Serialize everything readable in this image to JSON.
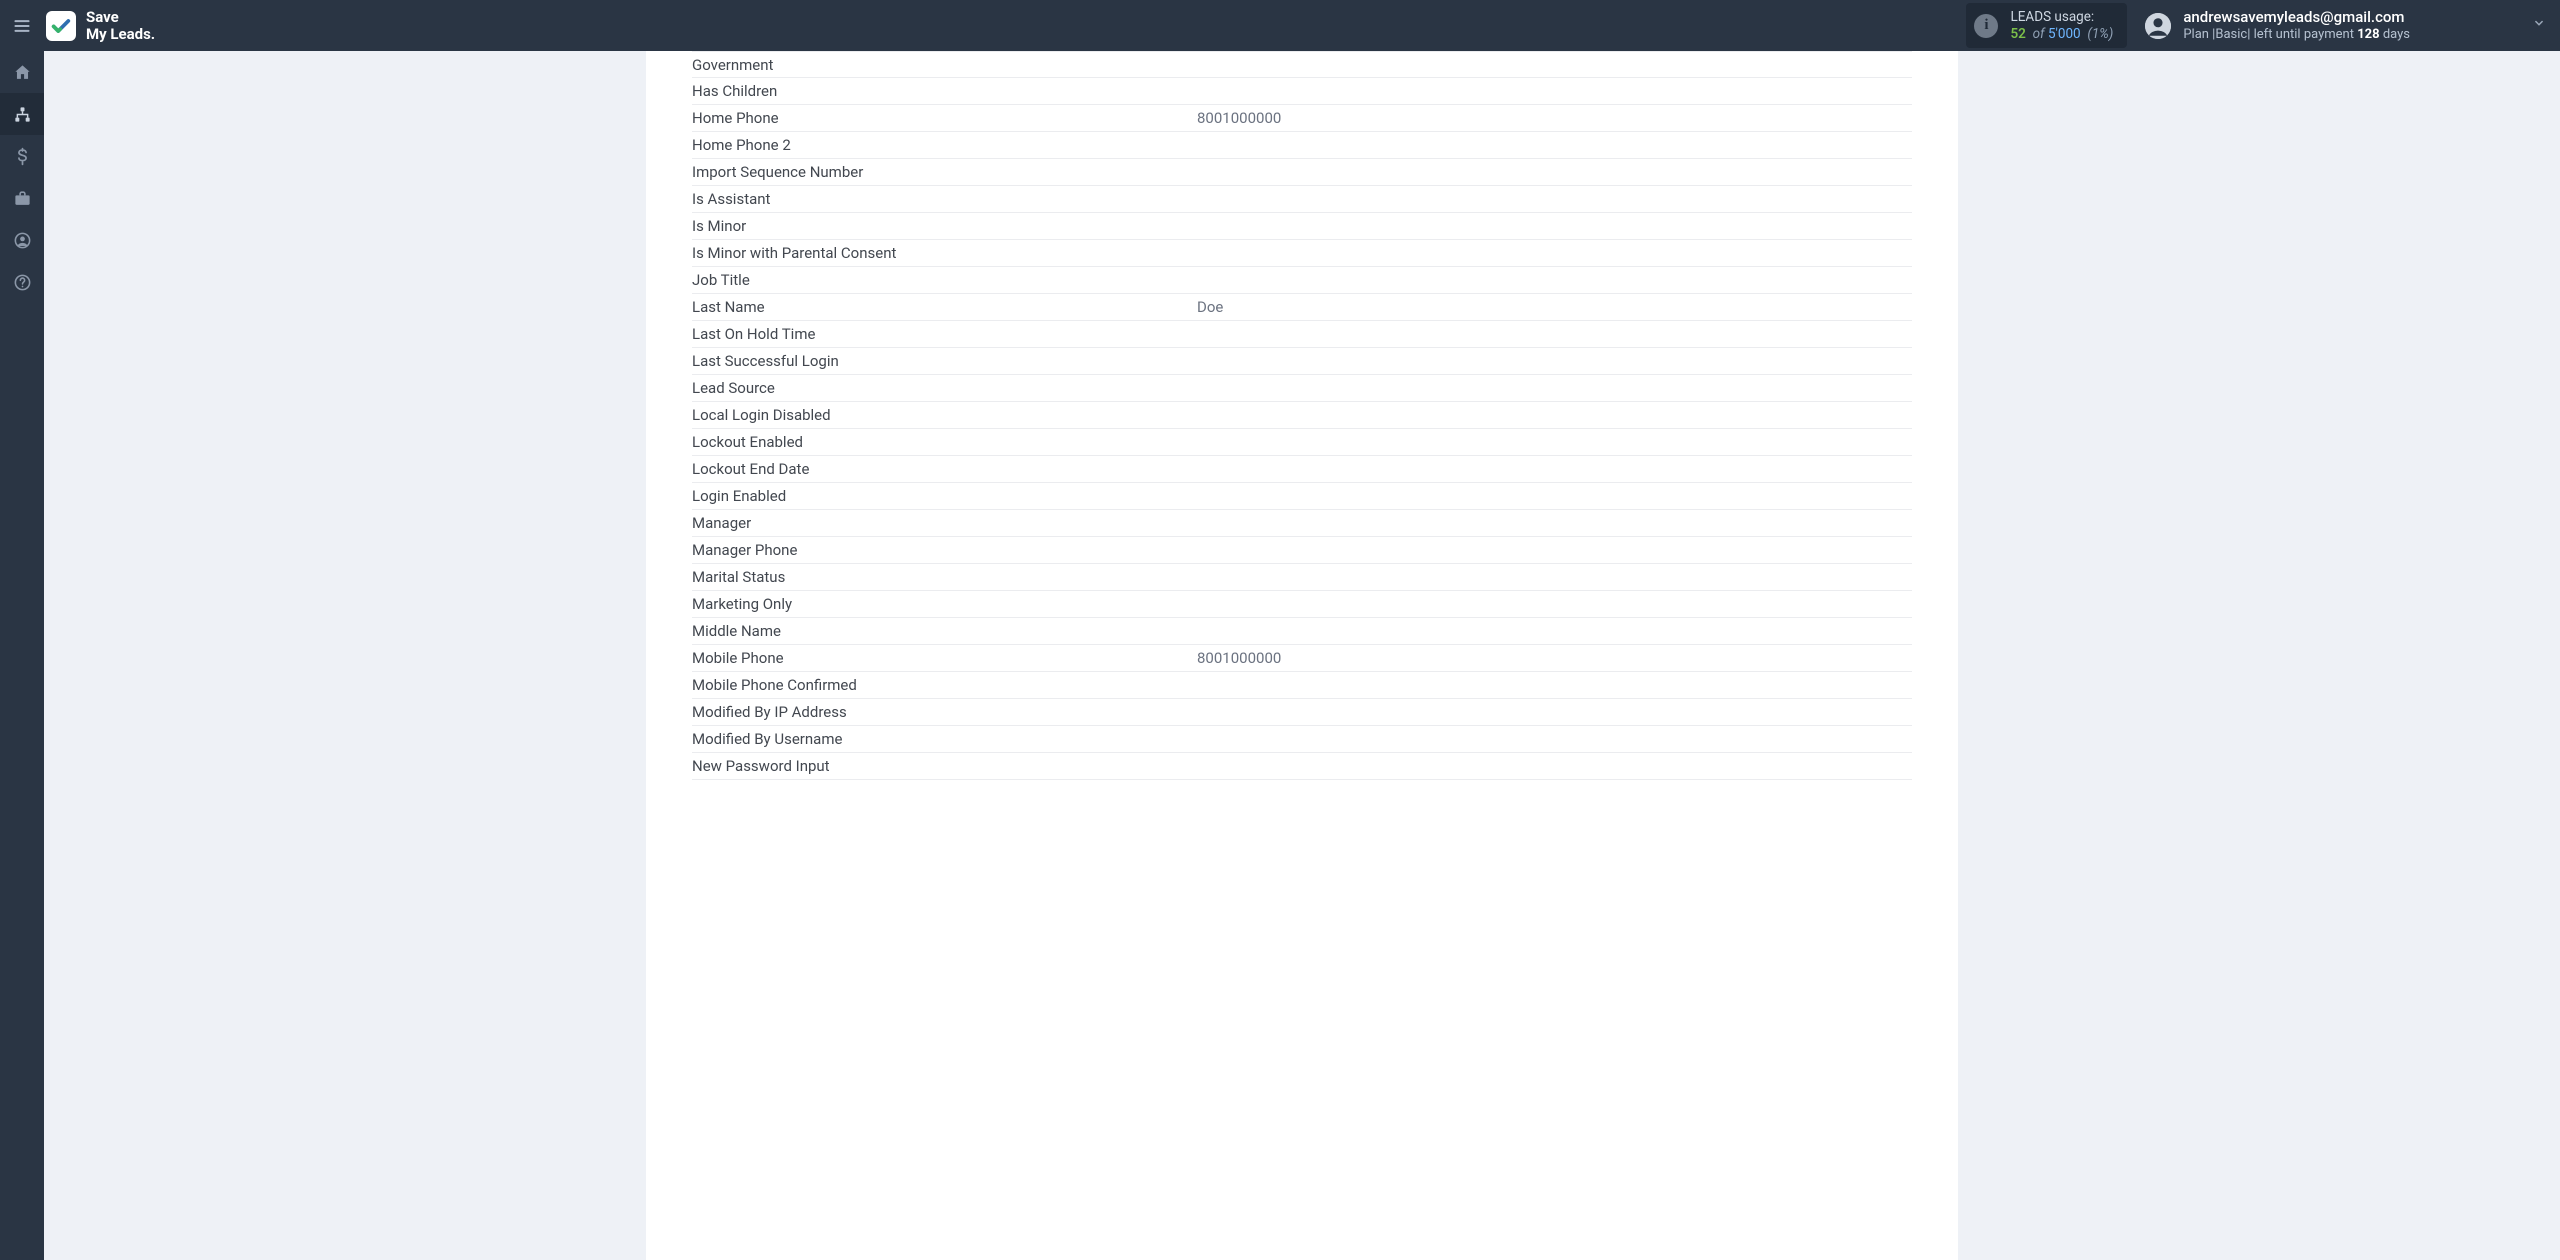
{
  "brand": {
    "line1": "Save",
    "line2": "My Leads."
  },
  "usage": {
    "label": "LEADS usage:",
    "used": "52",
    "of": "of",
    "total": "5'000",
    "pct": "(1%)"
  },
  "account": {
    "email": "andrewsavemyleads@gmail.com",
    "plan_prefix": "Plan |",
    "plan_name": "Basic",
    "plan_mid": "| left until payment ",
    "days_num": "128",
    "days_word": " days"
  },
  "sidebar": {
    "items": [
      {
        "name": "home"
      },
      {
        "name": "connections"
      },
      {
        "name": "billing"
      },
      {
        "name": "briefcase"
      },
      {
        "name": "profile"
      },
      {
        "name": "help"
      }
    ]
  },
  "fields": [
    {
      "label": "Government",
      "value": ""
    },
    {
      "label": "Has Children",
      "value": ""
    },
    {
      "label": "Home Phone",
      "value": "8001000000"
    },
    {
      "label": "Home Phone 2",
      "value": ""
    },
    {
      "label": "Import Sequence Number",
      "value": ""
    },
    {
      "label": "Is Assistant",
      "value": ""
    },
    {
      "label": "Is Minor",
      "value": ""
    },
    {
      "label": "Is Minor with Parental Consent",
      "value": ""
    },
    {
      "label": "Job Title",
      "value": ""
    },
    {
      "label": "Last Name",
      "value": "Doe"
    },
    {
      "label": "Last On Hold Time",
      "value": ""
    },
    {
      "label": "Last Successful Login",
      "value": ""
    },
    {
      "label": "Lead Source",
      "value": ""
    },
    {
      "label": "Local Login Disabled",
      "value": ""
    },
    {
      "label": "Lockout Enabled",
      "value": ""
    },
    {
      "label": "Lockout End Date",
      "value": ""
    },
    {
      "label": "Login Enabled",
      "value": ""
    },
    {
      "label": "Manager",
      "value": ""
    },
    {
      "label": "Manager Phone",
      "value": ""
    },
    {
      "label": "Marital Status",
      "value": ""
    },
    {
      "label": "Marketing Only",
      "value": ""
    },
    {
      "label": "Middle Name",
      "value": ""
    },
    {
      "label": "Mobile Phone",
      "value": "8001000000"
    },
    {
      "label": "Mobile Phone Confirmed",
      "value": ""
    },
    {
      "label": "Modified By IP Address",
      "value": ""
    },
    {
      "label": "Modified By Username",
      "value": ""
    },
    {
      "label": "New Password Input",
      "value": ""
    }
  ]
}
